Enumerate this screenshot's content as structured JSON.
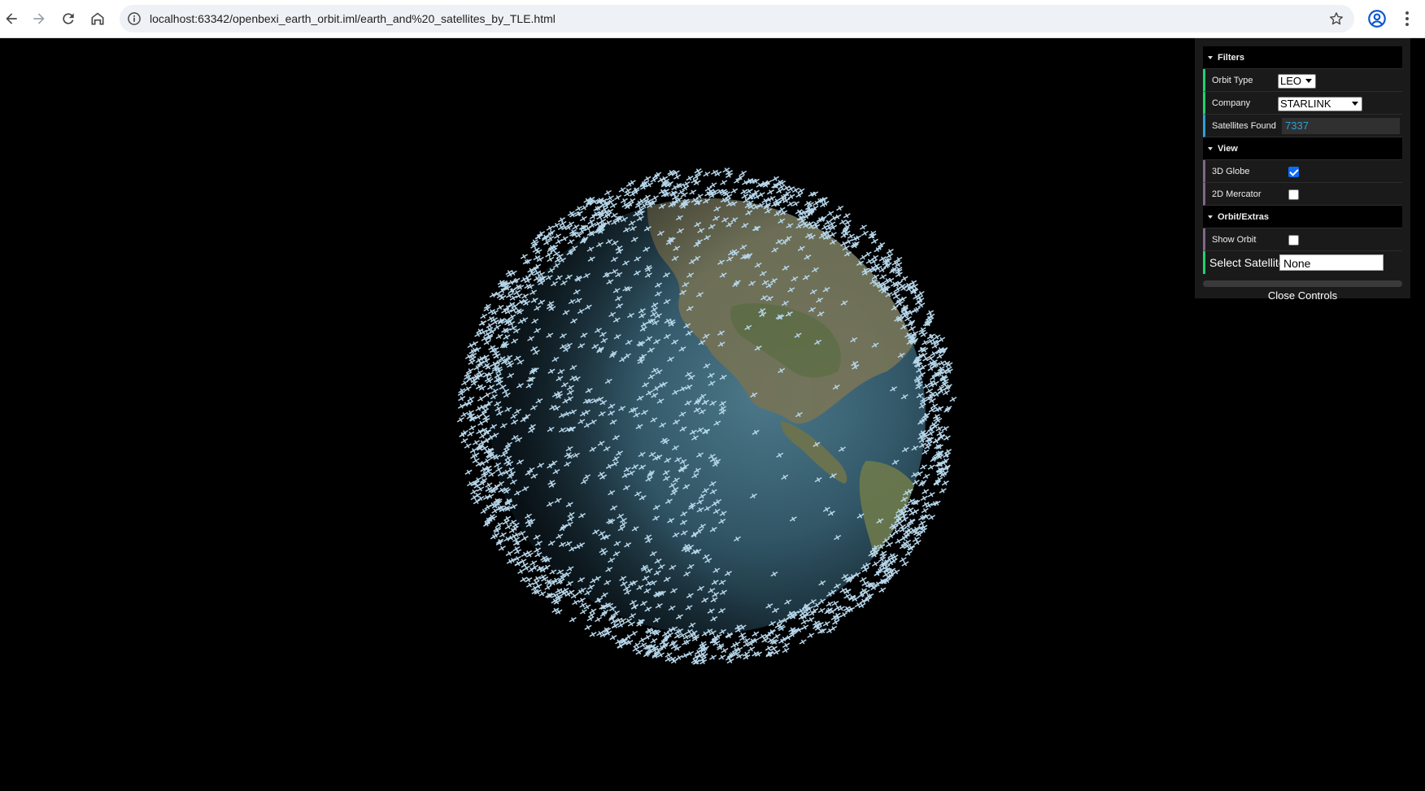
{
  "browser": {
    "url": "localhost:63342/openbexi_earth_orbit.iml/earth_and%20_satellites_by_TLE.html",
    "icons": [
      "back-icon",
      "forward-icon",
      "reload-icon",
      "home-icon",
      "site-info-icon",
      "bookmark-star-icon",
      "profile-icon",
      "menu-icon"
    ]
  },
  "scene": {
    "description_colors": {
      "satellite": "#a9cde3",
      "ocean": "#3a5e6e",
      "land": "#6f6a4f"
    }
  },
  "controls": {
    "filters_title": "Filters",
    "orbit_type_label": "Orbit Type",
    "orbit_type_value": "LEO",
    "company_label": "Company",
    "company_value": "STARLINK",
    "satellites_found_label": "Satellites Found",
    "satellites_found_value": "7337",
    "view_title": "View",
    "globe_3d_label": "3D Globe",
    "globe_3d_checked": true,
    "mercator_2d_label": "2D Mercator",
    "mercator_2d_checked": false,
    "orbit_extras_title": "Orbit/Extras",
    "show_orbit_label": "Show Orbit",
    "show_orbit_checked": false,
    "select_satellite_label": "Select Satellite",
    "select_satellite_value": "None",
    "close_label": "Close Controls"
  }
}
